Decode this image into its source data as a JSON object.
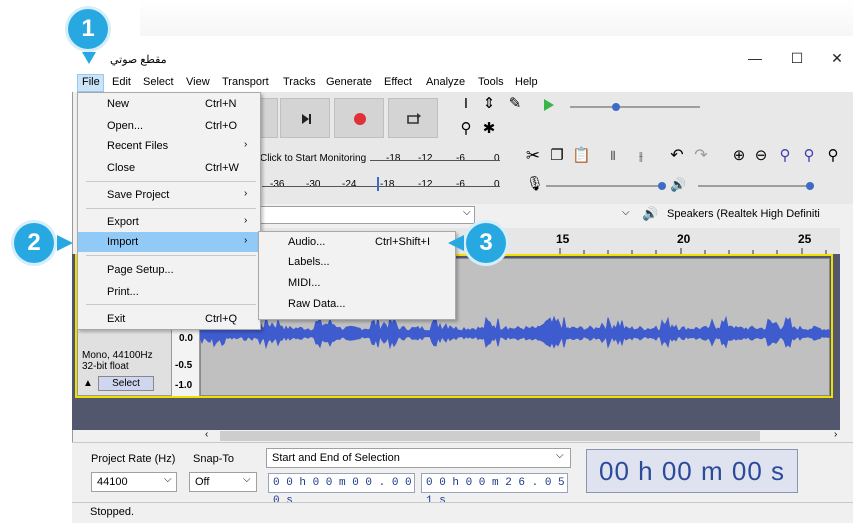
{
  "window": {
    "title": "مقطع صوتي",
    "minimize": "—",
    "maximize": "☐",
    "close": "✕"
  },
  "menubar": [
    "File",
    "Edit",
    "Select",
    "View",
    "Transport",
    "Tracks",
    "Generate",
    "Effect",
    "Analyze",
    "Tools",
    "Help"
  ],
  "file_menu": [
    {
      "label": "New",
      "shortcut": "Ctrl+N"
    },
    {
      "label": "Open...",
      "shortcut": "Ctrl+O"
    },
    {
      "label": "Recent Files",
      "submenu": true
    },
    {
      "label": "Close",
      "shortcut": "Ctrl+W"
    },
    {
      "label": "Save Project",
      "submenu": true
    },
    {
      "label": "Export",
      "submenu": true
    },
    {
      "label": "Import",
      "submenu": true,
      "highlighted": true
    },
    {
      "label": "Page Setup..."
    },
    {
      "label": "Print..."
    },
    {
      "label": "Exit",
      "shortcut": "Ctrl+Q"
    }
  ],
  "import_submenu": [
    {
      "label": "Audio...",
      "shortcut": "Ctrl+Shift+I"
    },
    {
      "label": "Labels..."
    },
    {
      "label": "MIDI..."
    },
    {
      "label": "Raw Data..."
    }
  ],
  "meter": {
    "monitor_text": "Click to Start Monitoring",
    "rec_ticks": [
      "-18",
      "-12",
      "-6",
      "0"
    ],
    "play_ticks": [
      "-36",
      "-30",
      "-24",
      "-18",
      "-12",
      "-6",
      "0"
    ]
  },
  "devices": {
    "playback_device": "Speakers (Realtek High Definiti"
  },
  "ruler": {
    "ticks": [
      "15",
      "20",
      "25"
    ]
  },
  "track": {
    "info_line1": "Mono, 44100Hz",
    "info_line2": "32-bit float",
    "select_label": "Select",
    "y_labels": [
      "0.0",
      "-0.5",
      "-1.0"
    ]
  },
  "selection_toolbar": {
    "project_rate_label": "Project Rate (Hz)",
    "snap_to_label": "Snap-To",
    "rate_value": "44100",
    "snap_value": "Off",
    "selection_mode": "Start and End of Selection",
    "start_time": "0 0 h 0 0 m 0 0 . 0 0 0 s",
    "end_time": "0 0 h 0 0 m 2 6 . 0 5 1 s",
    "audio_position": "00 h 00 m 00 s"
  },
  "status": {
    "text": "Stopped."
  },
  "callouts": [
    "1",
    "2",
    "3"
  ],
  "colors": {
    "callout": "#27a8e0",
    "waveform": "#3f5ccf",
    "track_bg": "#52576e",
    "highlight": "#91c9f7",
    "record": "#e0303a",
    "play": "#39b54a"
  }
}
